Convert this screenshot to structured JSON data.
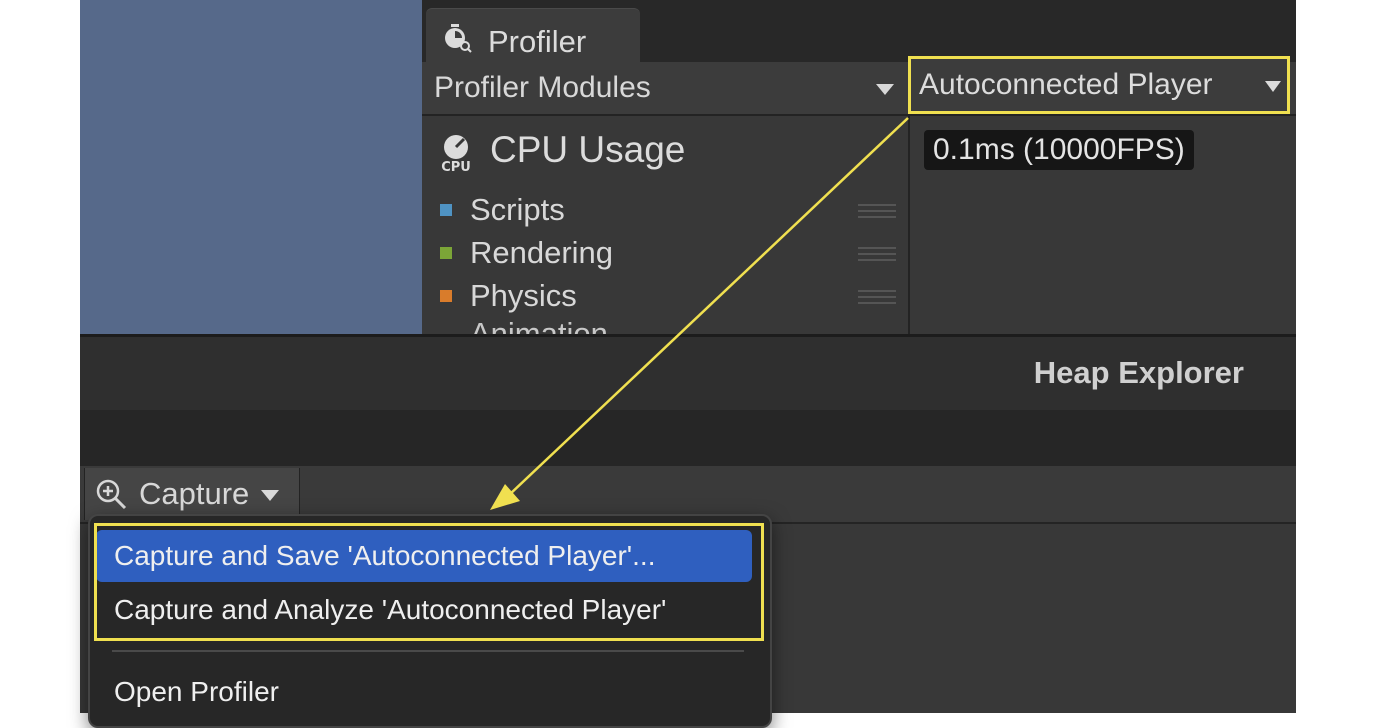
{
  "profiler": {
    "tab_title": "Profiler",
    "modules_label": "Profiler Modules",
    "target_dropdown": "Autoconnected Player",
    "module_title": "CPU Usage",
    "legend": [
      {
        "label": "Scripts",
        "color": "#4f93c3"
      },
      {
        "label": "Rendering",
        "color": "#7ba537"
      },
      {
        "label": "Physics",
        "color": "#d97c2b"
      },
      {
        "label": "Animation",
        "color": "#3a7fa0"
      }
    ],
    "frame_time": "0.1ms (10000FPS)"
  },
  "heap_explorer": {
    "title": "Heap Explorer",
    "capture_button": "Capture",
    "menu": {
      "items": [
        "Capture and Save 'Autoconnected Player'...",
        "Capture and Analyze 'Autoconnected Player'",
        "Open Profiler"
      ]
    }
  },
  "colors": {
    "highlight": "#f0e050",
    "menu_selected": "#2f5fbf",
    "scene_background": "#56698a"
  }
}
